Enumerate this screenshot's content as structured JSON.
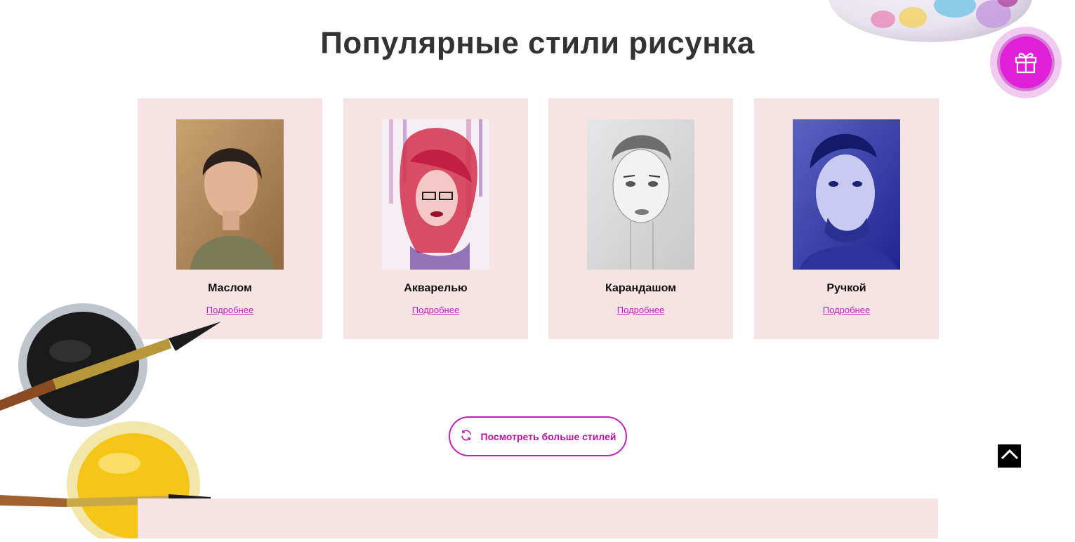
{
  "section": {
    "title": "Популярные стили рисунка"
  },
  "styles": [
    {
      "title": "Маслом",
      "link": "Подробнее"
    },
    {
      "title": "Акварелью",
      "link": "Подробнее"
    },
    {
      "title": "Карандашом",
      "link": "Подробнее"
    },
    {
      "title": "Ручкой",
      "link": "Подробнее"
    }
  ],
  "more_button": {
    "label": "Посмотреть больше стилей",
    "icon": "refresh-icon"
  },
  "floating": {
    "gift_icon": "gift-icon",
    "scroll_top_icon": "chevron-up-icon"
  },
  "colors": {
    "accent": "#c41fbc",
    "gift": "#e11fd8",
    "card_bg": "#f6e4e4",
    "title": "#333333"
  }
}
